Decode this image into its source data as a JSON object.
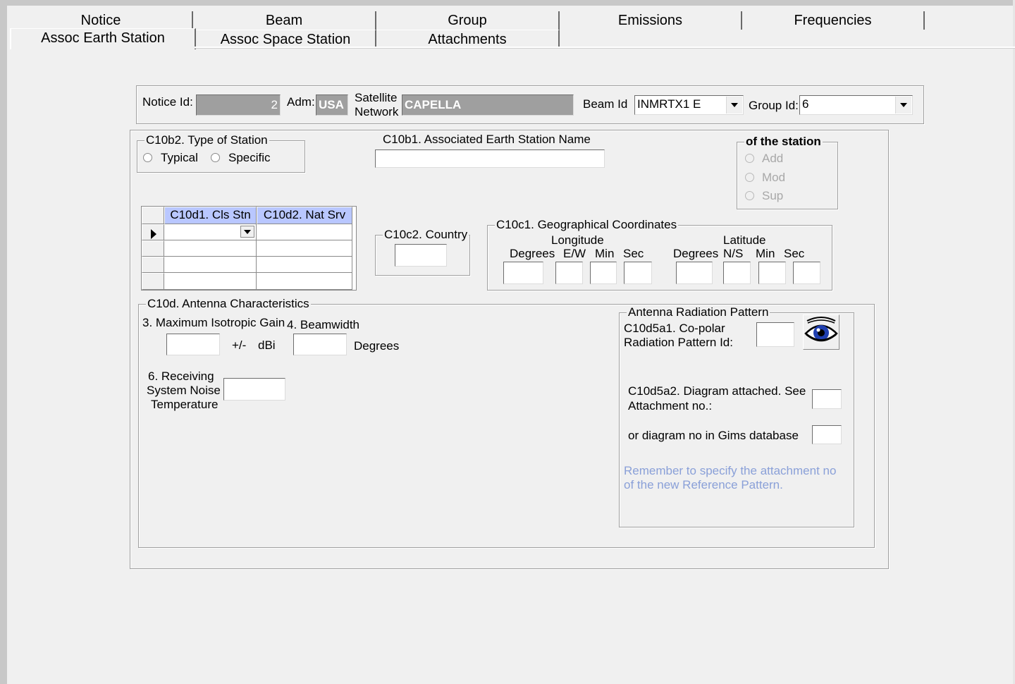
{
  "tabs": {
    "back": [
      "Notice",
      "Beam",
      "Group",
      "Emissions",
      "Frequencies"
    ],
    "front": [
      "Assoc Earth Station",
      "Assoc Space Station",
      "Attachments"
    ],
    "active": "Assoc Earth Station"
  },
  "header": {
    "notice_id_label": "Notice Id:",
    "notice_id_value": "2",
    "adm_label": "Adm:",
    "adm_value": "USA",
    "sat_label_1": "Satellite",
    "sat_label_2": "Network",
    "sat_value": "CAPELLA",
    "beam_label": "Beam Id",
    "beam_value": "INMRTX1 E",
    "group_label": "Group Id:",
    "group_value": "6"
  },
  "station_type": {
    "title": "C10b2. Type of Station",
    "typical": "Typical",
    "specific": "Specific"
  },
  "earth_station_name": {
    "label": "C10b1. Associated Earth Station Name",
    "value": ""
  },
  "of_station": {
    "title": "of the station",
    "add": "Add",
    "mod": "Mod",
    "sup": "Sup"
  },
  "grid": {
    "col1": "C10d1. Cls Stn",
    "col2": "C10d2. Nat Srv"
  },
  "country": {
    "title": "C10c2. Country"
  },
  "geo": {
    "title": "C10c1. Geographical Coordinates",
    "longitude": "Longitude",
    "latitude": "Latitude",
    "lon_deg": "Degrees",
    "lon_ew": "E/W",
    "lon_min": "Min",
    "lon_sec": "Sec",
    "lat_deg": "Degrees",
    "lat_ns": "N/S",
    "lat_min": "Min",
    "lat_sec": "Sec"
  },
  "antenna": {
    "title": "C10d.  Antenna Characteristics",
    "gain_label": "3. Maximum Isotropic Gain",
    "gain_unit_pm": "+/-",
    "gain_unit": "dBi",
    "beamwidth_label": "4. Beamwidth",
    "beamwidth_unit": "Degrees",
    "noise_1": "6. Receiving",
    "noise_2": "System Noise",
    "noise_3": "Temperature"
  },
  "pattern": {
    "title": "Antenna Radiation Pattern",
    "copolar_1": "C10d5a1. Co-polar",
    "copolar_2": "Radiation Pattern Id:",
    "diagram_1": "C10d5a2. Diagram attached.  See",
    "diagram_2": "Attachment no.:",
    "gims": "or diagram no in Gims database",
    "hint_1": "Remember to specify the attachment no",
    "hint_2": "of the new Reference Pattern."
  }
}
